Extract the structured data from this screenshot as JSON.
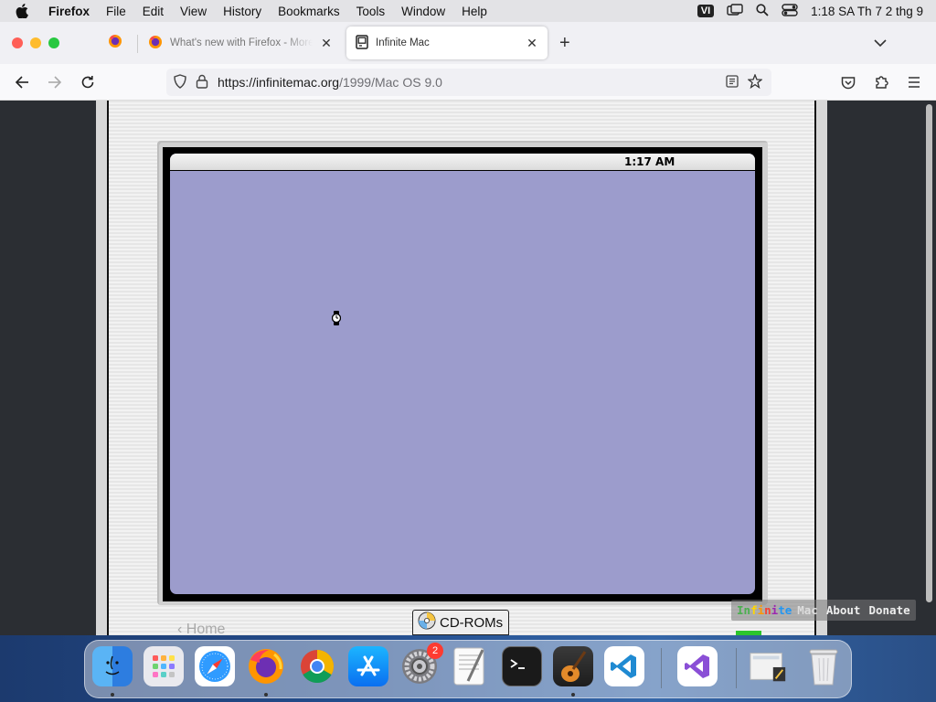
{
  "menubar": {
    "app_name": "Firefox",
    "items": [
      "File",
      "Edit",
      "View",
      "History",
      "Bookmarks",
      "Tools",
      "Window",
      "Help"
    ],
    "input_method": "VI",
    "clock": "1:18 SA Th 7 2 thg 9"
  },
  "tabs": {
    "inactive_title": "What's new with Firefox - More",
    "active_title": "Infinite Mac"
  },
  "navbar": {
    "url_host": "https://infinitemac.org",
    "url_path": "/1999/Mac OS 9.0"
  },
  "emulator": {
    "clock": "1:17 AM",
    "home_link": "‹ Home",
    "cdroms_label": "CD-ROMs",
    "footer": {
      "logo_letters": [
        "In",
        "f",
        "i",
        "n",
        "i",
        "te"
      ],
      "logo_suffix": "Mac",
      "about": "About",
      "donate": "Donate"
    }
  },
  "dock": {
    "apps": [
      "finder-icon",
      "launchpad-icon",
      "safari-icon",
      "firefox-icon",
      "chrome-icon",
      "app-store-icon",
      "system-settings-icon",
      "textedit-icon",
      "terminal-icon",
      "garageband-icon",
      "vscode-icon",
      "visual-studio-icon",
      "downloads-stack-icon",
      "trash-icon"
    ],
    "settings_badge": "2"
  },
  "colors": {
    "mac_desktop": "#9c9ccc",
    "dock_badge": "#ff3b30"
  }
}
